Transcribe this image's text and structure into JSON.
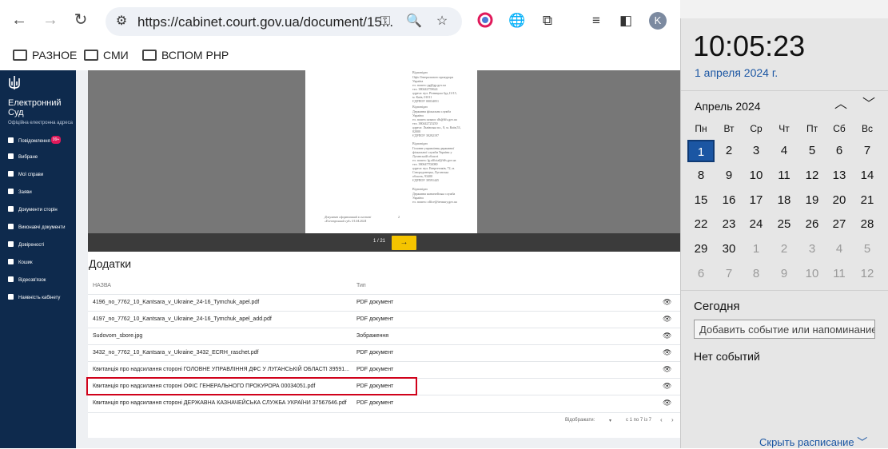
{
  "browser": {
    "url": "https://cabinet.court.gov.ua/document/15...",
    "avatar_letter": "K",
    "bookmarks": [
      {
        "label": "РАЗНОЕ"
      },
      {
        "label": "СМИ"
      },
      {
        "label": "ВСПОМ РНР"
      }
    ]
  },
  "sidebar": {
    "brand": "Електронний Суд",
    "subtitle": "Офіційна електронна адреса",
    "items": [
      {
        "label": "Повідомлення",
        "badge": "99+"
      },
      {
        "label": "Вибране"
      },
      {
        "label": "Мої справи"
      },
      {
        "label": "Заяви"
      },
      {
        "label": "Документи сторін"
      },
      {
        "label": "Виконавчі документи"
      },
      {
        "label": "Довіреності"
      },
      {
        "label": "Кошик"
      },
      {
        "label": "Відеозв'язок"
      },
      {
        "label": "Наявність кабінету"
      }
    ]
  },
  "viewer": {
    "page_indicator": "1 / 21",
    "next_icon": "arrow-right-icon",
    "page_text": {
      "b1_title": "Відповідач",
      "b1_lines": [
        "Офіс Генерального прокурора",
        "Україна",
        "ел. пошта: pg@gp.gov.ua",
        "тел. 380442759624",
        "адреса: вул. Різницька буд.13/15,",
        "м. Київ, 01011",
        "ЄДРПОУ 00034051"
      ],
      "b2_title": "Відповідач",
      "b2_lines": [
        "Державна фіскальна служба",
        "України",
        "ел. пошта шляхи: dfs@dfs.gov.ua",
        "тел. 380442725250",
        "адреса: Львівська пл., 8, м. Київ,53,",
        "02000",
        "ЄДРПОУ 39292197"
      ],
      "b3_title": "Відповідач",
      "b3_lines": [
        "Головне управління державної",
        "фіскальної служби України у",
        "Луганській області",
        "ел. пошта: lg.official@dfs.gov.ua",
        "тел. 380647702080",
        "адреса: вул. Енергетиків, 72, м.",
        "Сєвєродонецьк, Луганська",
        "область, 93400",
        "ЄДРПОУ 39591445"
      ],
      "b4_title": "Відповідач",
      "b4_lines": [
        "Державна казначейська служба",
        "України",
        "ел. пошта: office@treasury.gov.ua"
      ],
      "footer_lines": [
        "Документ сформований в системі",
        "«Електронний суд» 01.04.2024"
      ],
      "footer_page": "2"
    }
  },
  "attachments": {
    "title": "Додатки",
    "col_name": "НАЗВА",
    "col_type": "Тип",
    "rows": [
      {
        "name": "4196_no_7762_10_Kantsara_v_Ukraine_24-16_Tymchuk_apel.pdf",
        "type": "PDF документ"
      },
      {
        "name": "4197_no_7762_10_Kantsara_v_Ukraine_24-16_Tymchuk_apel_add.pdf",
        "type": "PDF документ"
      },
      {
        "name": "Sudovom_sbore.jpg",
        "type": "Зображення"
      },
      {
        "name": "3432_no_7762_10_Kantsara_v_Ukraine_3432_ECRH_raschet.pdf",
        "type": "PDF документ"
      },
      {
        "name": "Квитанція про надсилання стороні ГОЛОВНЕ УПРАВЛІННЯ ДФС У ЛУГАНСЬКІЙ ОБЛАСТІ 39591...",
        "type": "PDF документ"
      },
      {
        "name": "Квитанція про надсилання стороні ОФІС ГЕНЕРАЛЬНОГО ПРОКУРОРА 00034051.pdf",
        "type": "PDF документ"
      },
      {
        "name": "Квитанція про надсилання стороні ДЕРЖАВНА КАЗНАЧЕЙСЬКА СЛУЖБА УКРАЇНИ 37567646.pdf",
        "type": "PDF документ"
      }
    ],
    "footer": {
      "per_page_label": "Відображати:",
      "range": "с 1 по 7 із 7"
    }
  },
  "clock": {
    "time": "10:05:23",
    "date": "1 апреля 2024 г.",
    "month": "Апрель 2024",
    "weekdays": [
      "Пн",
      "Вт",
      "Ср",
      "Чт",
      "Пт",
      "Сб",
      "Вс"
    ],
    "weeks": [
      [
        "1",
        "2",
        "3",
        "4",
        "5",
        "6",
        "7"
      ],
      [
        "8",
        "9",
        "10",
        "11",
        "12",
        "13",
        "14"
      ],
      [
        "15",
        "16",
        "17",
        "18",
        "19",
        "20",
        "21"
      ],
      [
        "22",
        "23",
        "24",
        "25",
        "26",
        "27",
        "28"
      ],
      [
        "29",
        "30",
        "1",
        "2",
        "3",
        "4",
        "5"
      ],
      [
        "6",
        "7",
        "8",
        "9",
        "10",
        "11",
        "12"
      ]
    ],
    "today_label": "Сегодня",
    "event_placeholder": "Добавить событие или напоминание",
    "no_events": "Нет событий",
    "hide_schedule": "Скрыть расписание"
  }
}
